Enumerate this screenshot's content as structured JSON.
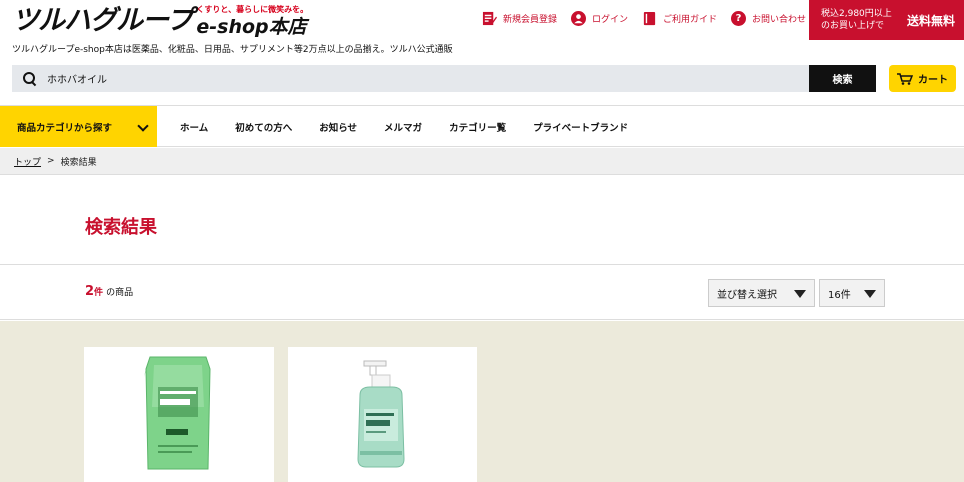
{
  "header": {
    "logo_main": "ツルハグループ",
    "logo_tagline": "くすりと、暮らしに微笑みを。",
    "logo_shop": "e-shop本店",
    "subtitle": "ツルハグループe-shop本店は医薬品、化粧品、日用品、サプリメント等2万点以上の品揃え。ツルハ公式通販",
    "top_links": [
      {
        "label": "新規会員登録",
        "icon": "register-icon"
      },
      {
        "label": "ログイン",
        "icon": "login-icon"
      },
      {
        "label": "ご利用ガイド",
        "icon": "guide-icon"
      },
      {
        "label": "お問い合わせ",
        "icon": "question-icon"
      }
    ],
    "shipping_condition": "税込2,980円以上のお買い上げで",
    "shipping_free": "送料無料"
  },
  "search": {
    "value": "ホホバオイル",
    "button_label": "検索"
  },
  "cart": {
    "label": "カート"
  },
  "nav": {
    "category_button": "商品カテゴリから探す",
    "items": [
      "ホーム",
      "初めての方へ",
      "お知らせ",
      "メルマガ",
      "カテゴリー覧",
      "プライベートブランド"
    ]
  },
  "breadcrumb": {
    "home": "トップ",
    "separator": ">",
    "current": "検索結果"
  },
  "page_title": "検索結果",
  "results": {
    "count": "2",
    "count_unit": "件",
    "count_label": "の商品",
    "sort_label": "並び替え選択",
    "per_page": "16件"
  },
  "colors": {
    "brand_red": "#c8102e",
    "accent_yellow": "#ffd400",
    "product_bg": "#eceadb"
  }
}
